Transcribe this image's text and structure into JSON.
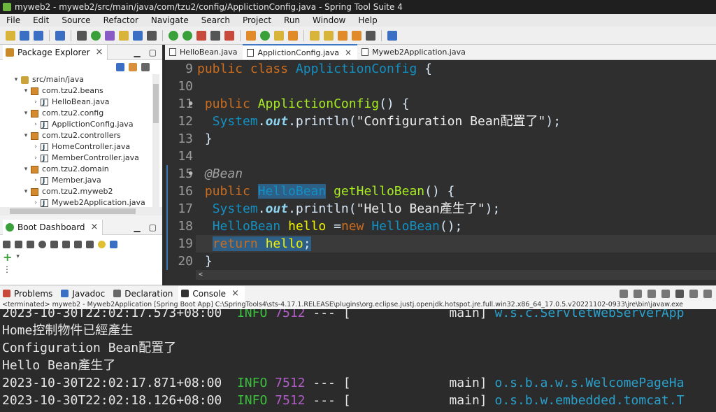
{
  "window": {
    "title": "myweb2 - myweb2/src/main/java/com/tzu2/config/ApplictionConfig.java - Spring Tool Suite 4"
  },
  "menu": [
    "File",
    "Edit",
    "Source",
    "Refactor",
    "Navigate",
    "Search",
    "Project",
    "Run",
    "Window",
    "Help"
  ],
  "package_explorer": {
    "title": "Package Explorer",
    "tree": [
      {
        "label": "src/main/java",
        "indent": 1,
        "type": "src",
        "expanded": true
      },
      {
        "label": "com.tzu2.beans",
        "indent": 2,
        "type": "pkg",
        "expanded": true
      },
      {
        "label": "HelloBean.java",
        "indent": 3,
        "type": "java",
        "expanded": false
      },
      {
        "label": "com.tzu2.config",
        "indent": 2,
        "type": "pkg",
        "expanded": true
      },
      {
        "label": "ApplictionConfig.java",
        "indent": 3,
        "type": "java",
        "expanded": false
      },
      {
        "label": "com.tzu2.controllers",
        "indent": 2,
        "type": "pkg",
        "expanded": true
      },
      {
        "label": "HomeController.java",
        "indent": 3,
        "type": "java",
        "expanded": false
      },
      {
        "label": "MemberController.java",
        "indent": 3,
        "type": "java",
        "expanded": false
      },
      {
        "label": "com.tzu2.domain",
        "indent": 2,
        "type": "pkg",
        "expanded": true
      },
      {
        "label": "Member.java",
        "indent": 3,
        "type": "java",
        "expanded": false
      },
      {
        "label": "com.tzu2.myweb2",
        "indent": 2,
        "type": "pkg",
        "expanded": true
      },
      {
        "label": "Myweb2Application.java",
        "indent": 3,
        "type": "java",
        "expanded": false
      }
    ]
  },
  "boot_dashboard": {
    "title": "Boot Dashboard"
  },
  "editor": {
    "tabs": [
      {
        "label": "HelloBean.java",
        "active": false
      },
      {
        "label": "ApplictionConfig.java",
        "active": true
      },
      {
        "label": "Myweb2Application.java",
        "active": false
      }
    ],
    "lines": [
      {
        "num": "9",
        "fold": "",
        "html": "<span class='kw'>public</span> <span class='kw'>class</span> <span class='cls'>ApplictionConfig</span> {"
      },
      {
        "num": "10",
        "fold": "",
        "html": ""
      },
      {
        "num": "11",
        "fold": "●",
        "html": "<span class='kw'> public</span> <span class='mth'>ApplictionConfig</span>() {"
      },
      {
        "num": "12",
        "fold": "",
        "html": "  <span class='cls'>System</span>.<span class='fld'>out</span>.println(<span class='str'>\"Configuration Bean配置了\"</span>);"
      },
      {
        "num": "13",
        "fold": "",
        "html": " }"
      },
      {
        "num": "14",
        "fold": "",
        "html": ""
      },
      {
        "num": "15",
        "fold": "●",
        "html": " <span class='ann'>@Bean</span>"
      },
      {
        "num": "16",
        "fold": "",
        "html": "<span class='kw'> public</span> <span class='cls sel'>HelloBean</span> <span class='mth'>getHelloBean</span>() {"
      },
      {
        "num": "17",
        "fold": "",
        "html": "  <span class='cls'>System</span>.<span class='fld'>out</span>.println(<span class='str'>\"Hello Bean產生了\"</span>);"
      },
      {
        "num": "18",
        "fold": "",
        "html": "  <span class='cls'>HelloBean</span> <span class='var'>hello</span> =<span class='kw'>new</span> <span class='cls'>HelloBean</span>();"
      },
      {
        "num": "19",
        "fold": "",
        "html": "  <span class='sel'><span class='kw'>return</span> <span class='var'>hello</span>;</span>"
      },
      {
        "num": "20",
        "fold": "",
        "html": " }"
      }
    ]
  },
  "console": {
    "tabs": [
      {
        "label": "Problems",
        "active": false
      },
      {
        "label": "Javadoc",
        "active": false
      },
      {
        "label": "Declaration",
        "active": false
      },
      {
        "label": "Console",
        "active": true
      }
    ],
    "terminated": "<terminated> myweb2 - Myweb2Application [Spring Boot App] C:\\SpringTools4\\sts-4.17.1.RELEASE\\plugins\\org.eclipse.justj.openjdk.hotspot.jre.full.win32.x86_64_17.0.5.v20221102-0933\\jre\\bin\\javaw.exe",
    "lines": [
      {
        "ts": "2023-10-30T22:02:17.573+08:00",
        "level": "INFO",
        "pid": "7512",
        "sep": "--- [",
        "thread": "main]",
        "cls": "w.s.c.ServletWebServerApp",
        "text": ""
      },
      {
        "ts": "",
        "level": "",
        "pid": "",
        "sep": "",
        "thread": "",
        "cls": "",
        "text": "Home控制物件已經產生"
      },
      {
        "ts": "",
        "level": "",
        "pid": "",
        "sep": "",
        "thread": "",
        "cls": "",
        "text": "Configuration Bean配置了"
      },
      {
        "ts": "",
        "level": "",
        "pid": "",
        "sep": "",
        "thread": "",
        "cls": "",
        "text": "Hello Bean產生了"
      },
      {
        "ts": "2023-10-30T22:02:17.871+08:00",
        "level": "INFO",
        "pid": "7512",
        "sep": "--- [",
        "thread": "main]",
        "cls": "o.s.b.a.w.s.WelcomePageHa",
        "text": ""
      },
      {
        "ts": "2023-10-30T22:02:18.126+08:00",
        "level": "INFO",
        "pid": "7512",
        "sep": "--- [",
        "thread": "main]",
        "cls": "o.s.b.w.embedded.tomcat.T",
        "text": ""
      }
    ]
  }
}
